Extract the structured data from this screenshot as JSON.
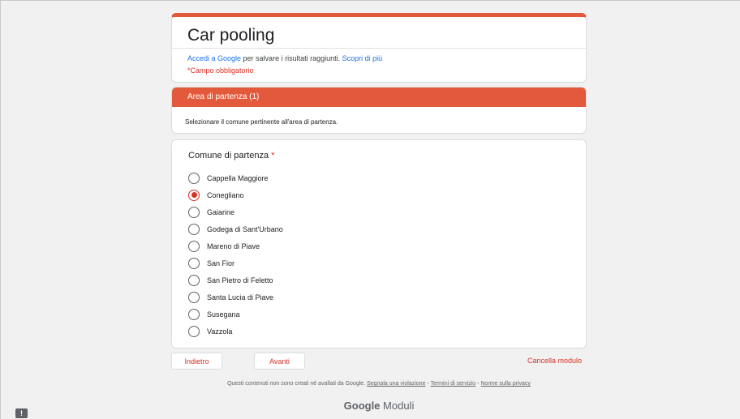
{
  "form": {
    "title": "Car pooling",
    "signin_link": "Accedi a Google",
    "signin_text": " per salvare i risultati raggiunti. ",
    "learn_more_link": "Scopri di più",
    "required_note": "*Campo obbligatorio"
  },
  "section": {
    "title": "Area di partenza (1)",
    "description": "Selezionare il comune pertinente all'area di partenza."
  },
  "question": {
    "title": "Comune di partenza",
    "required_marker": "*",
    "selected": "Conegliano",
    "options": [
      "Cappella Maggiore",
      "Conegliano",
      "Gaiarine",
      "Godega di Sant'Urbano",
      "Mareno di Piave",
      "San Fior",
      "San Pietro di Feletto",
      "Santa Lucia di Piave",
      "Susegana",
      "Vazzola"
    ]
  },
  "nav": {
    "back_label": "Indietro",
    "next_label": "Avanti",
    "clear_label": "Cancella modulo"
  },
  "footer": {
    "disclaimer_prefix": "Questi contenuti non sono creati né avallati da Google. ",
    "report_link": "Segnala una violazione",
    "sep1": " - ",
    "terms_link": "Termini di servizio",
    "sep2": " - ",
    "policy_link": "Norme sulla privacy",
    "brand_google": "Google",
    "brand_product": " Moduli",
    "feedback_glyph": "!"
  },
  "colors": {
    "accent": "#e25a3b",
    "required": "#d93025",
    "link": "#1a73e8"
  },
  "icons": {
    "feedback": "report-feedback-icon"
  }
}
